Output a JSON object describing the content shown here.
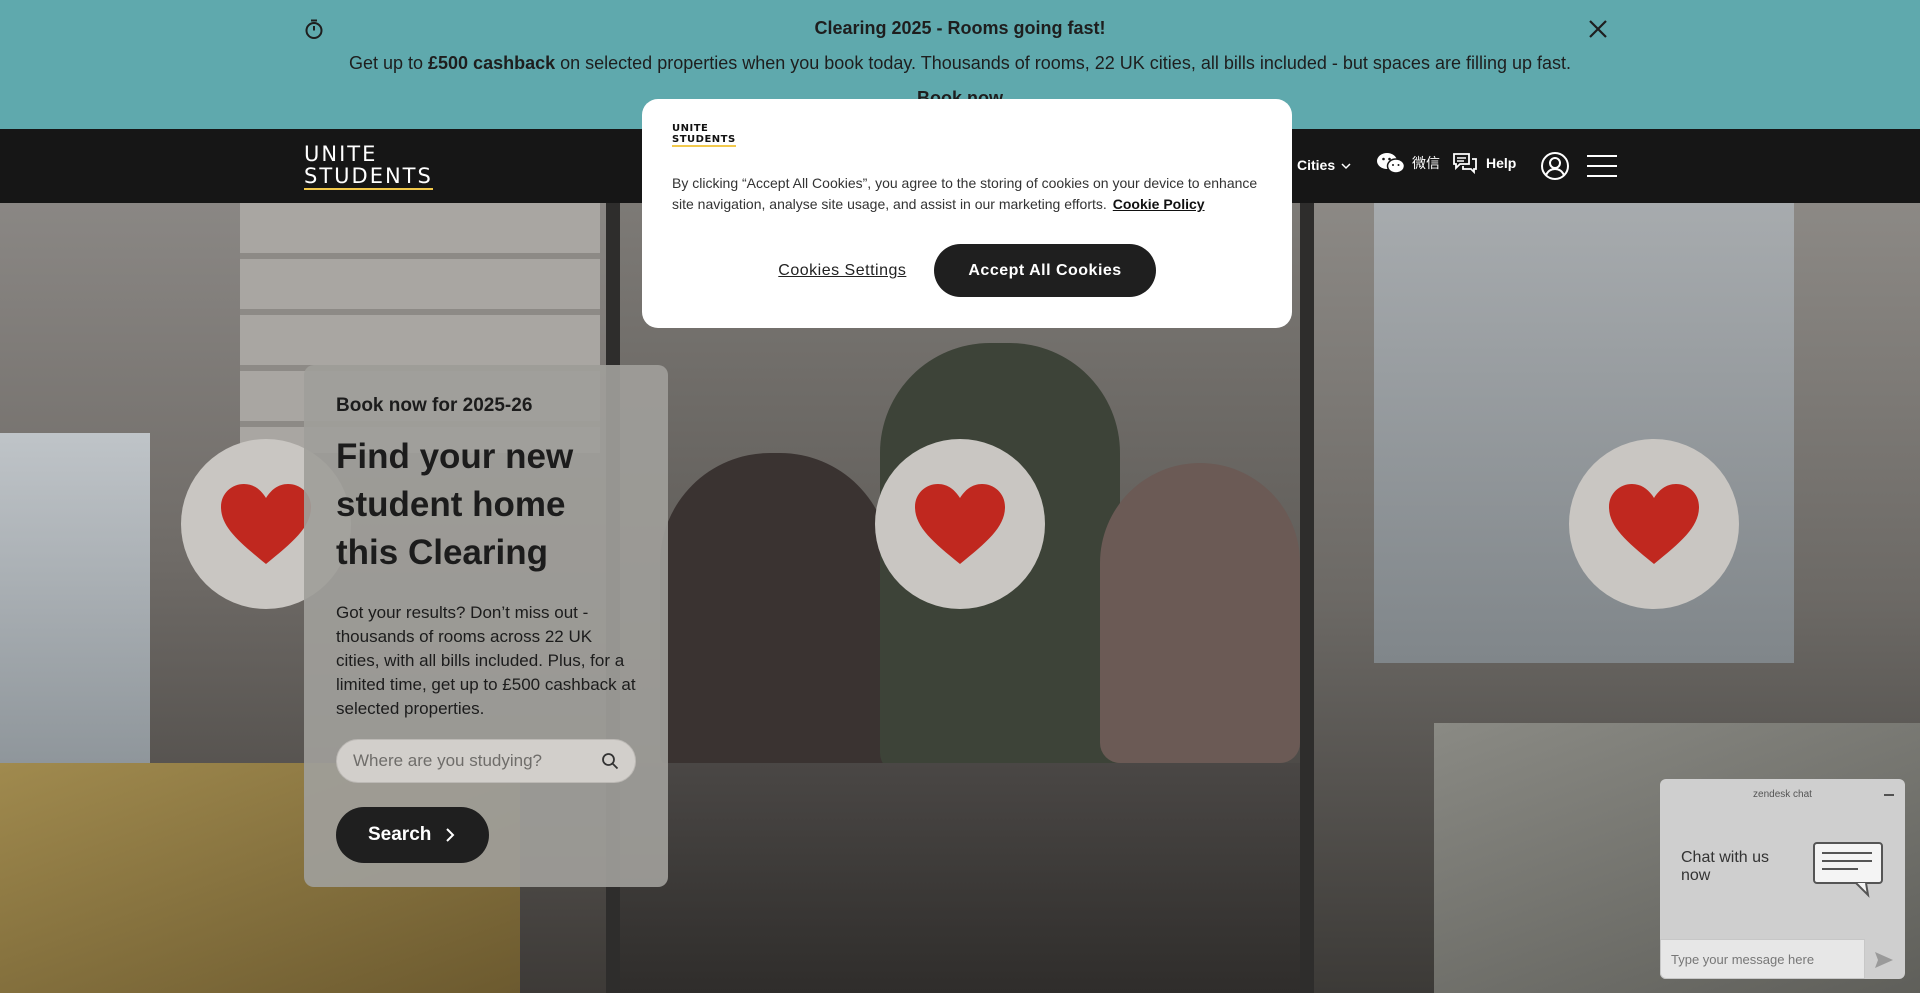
{
  "banner": {
    "title": "Clearing 2025 - Rooms going fast!",
    "text_prefix": "Get up to ",
    "text_bold": "£500 cashback",
    "text_suffix": " on selected properties when you book today. Thousands of rooms, 22 UK cities, all bills included - but spaces are filling up fast.",
    "link": "Book now",
    "timer_icon": "stopwatch-icon",
    "close_icon": "close-icon",
    "bg_color": "#5fa9ad"
  },
  "header": {
    "logo_line1": "UNITE",
    "logo_line2": "STUDENTS",
    "nav": {
      "cities": "Cities",
      "wechat": "微信",
      "help": "Help"
    },
    "icons": {
      "wechat": "wechat-icon",
      "help": "chat-bubbles-icon",
      "account": "user-circle-icon",
      "menu": "hamburger-menu-icon",
      "chevron": "chevron-down-icon"
    }
  },
  "hero": {
    "eyebrow": "Book now for 2025-26",
    "heading": "Find your new student home this Clearing",
    "description": "Got your results? Don’t miss out - thousands of rooms across 22 UK cities, with all bills included. Plus, for a limited time, get up to £500 cashback at selected properties.",
    "search_placeholder": "Where are you studying?",
    "search_button": "Search",
    "heart_icon": "heart-icon",
    "heart_color": "#c0281f"
  },
  "cookie_banner": {
    "logo_line1": "UNITE",
    "logo_line2": "STUDENTS",
    "text": "By clicking “Accept All Cookies”, you agree to the storing of cookies on your device to enhance site navigation, analyse site usage, and assist in our marketing efforts.",
    "policy_link": "Cookie Policy",
    "settings_button": "Cookies Settings",
    "accept_button": "Accept All Cookies"
  },
  "chat_widget": {
    "header": "zendesk chat",
    "title": "Chat with us now",
    "input_placeholder": "Type your message here",
    "icons": {
      "minimize": "minimize-icon",
      "chat": "chat-speech-bubble-icon",
      "send": "send-icon"
    }
  }
}
